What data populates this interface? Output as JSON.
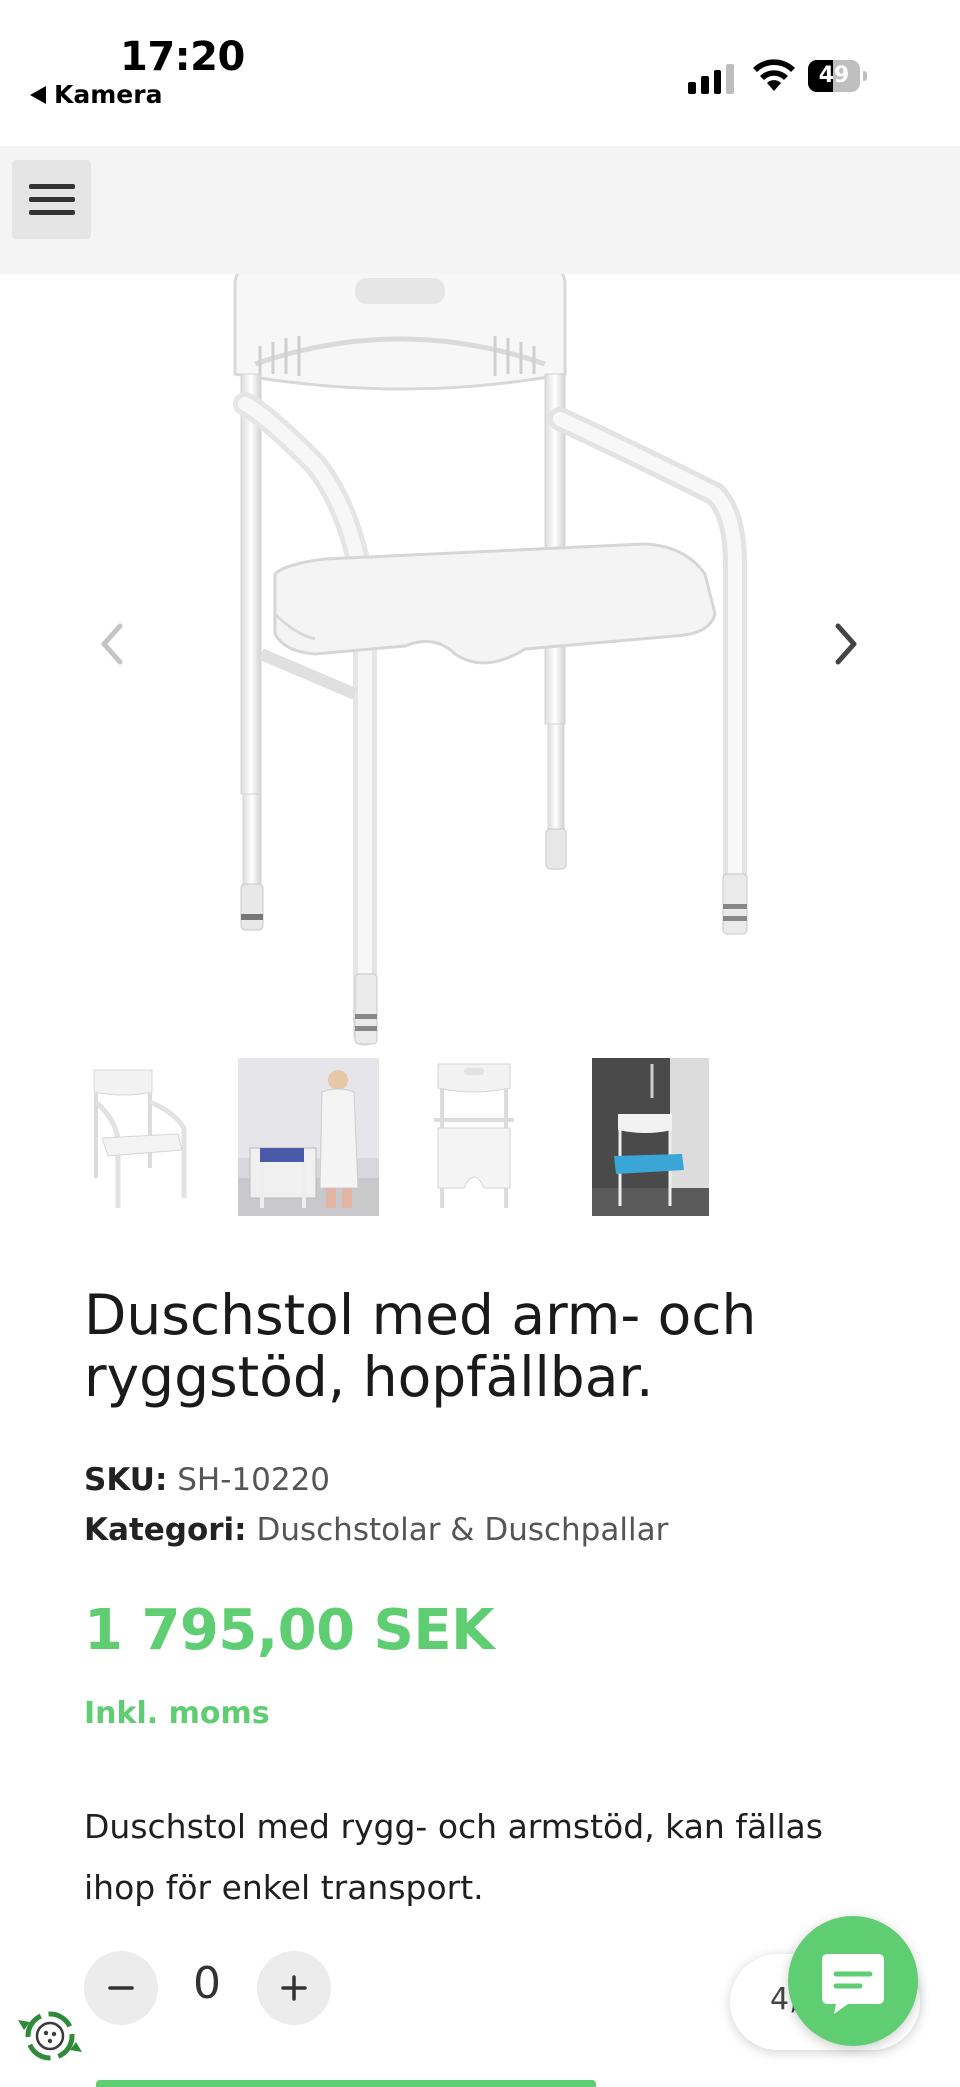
{
  "status_bar": {
    "time": "17:20",
    "back_label": "Kamera",
    "battery_level": "49",
    "battery_fraction": 0.49
  },
  "header": {
    "menu_icon": "hamburger-menu-icon"
  },
  "gallery": {
    "prev_icon": "chevron-left-icon",
    "next_icon": "chevron-right-icon",
    "thumbnails": [
      {
        "name": "thumb-chair-front"
      },
      {
        "name": "thumb-chair-in-use"
      },
      {
        "name": "thumb-chair-folded"
      },
      {
        "name": "thumb-chair-in-shower"
      }
    ]
  },
  "product": {
    "title": "Duschstol med arm- och ryggstöd, hopfällbar.",
    "sku_label": "SKU:",
    "sku_value": "SH-10220",
    "category_label": "Kategori:",
    "category_value": "Duschstolar & Duschpallar",
    "price": "1 795,00 SEK",
    "vat_note": "Inkl. moms",
    "description": "Duschstol med rygg- och armstöd, kan fällas ihop för enkel transport."
  },
  "quantity": {
    "value": "0"
  },
  "widgets": {
    "rating_text": "4,",
    "chat_icon": "chat-bubble-icon",
    "eco_icon": "recycle-badge-icon"
  },
  "colors": {
    "accent_green": "#5fcd71",
    "header_bg": "#f4f4f4",
    "text_dark": "#1f1f1f",
    "muted": "#555555"
  }
}
